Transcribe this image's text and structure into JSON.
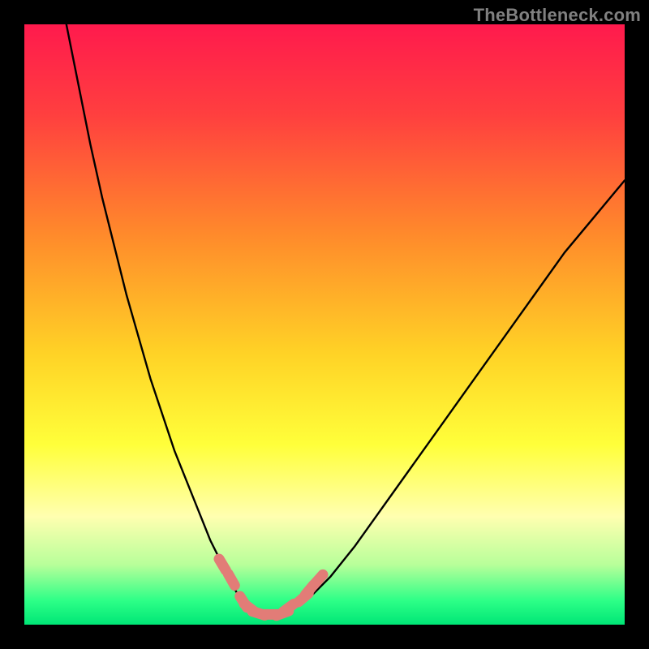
{
  "watermark": "TheBottleneck.com",
  "chart_data": {
    "type": "line",
    "title": "",
    "xlabel": "",
    "ylabel": "",
    "xlim": [
      0,
      100
    ],
    "ylim": [
      0,
      100
    ],
    "grid": false,
    "legend": false,
    "gradient_stops": [
      {
        "offset": 0.0,
        "color": "#ff1a4d"
      },
      {
        "offset": 0.15,
        "color": "#ff3f3f"
      },
      {
        "offset": 0.35,
        "color": "#ff8a2b"
      },
      {
        "offset": 0.55,
        "color": "#ffd326"
      },
      {
        "offset": 0.7,
        "color": "#ffff3a"
      },
      {
        "offset": 0.82,
        "color": "#ffffb0"
      },
      {
        "offset": 0.9,
        "color": "#b8ff9a"
      },
      {
        "offset": 0.96,
        "color": "#2dff87"
      },
      {
        "offset": 1.0,
        "color": "#00e676"
      }
    ],
    "series": [
      {
        "name": "left-curve",
        "stroke": "#000000",
        "x": [
          7,
          9,
          11,
          13,
          15,
          17,
          19,
          21,
          23,
          25,
          27,
          29,
          31,
          33,
          35,
          36.5,
          37.5
        ],
        "y": [
          100,
          90,
          80,
          71,
          63,
          55,
          48,
          41,
          35,
          29,
          24,
          19,
          14,
          10,
          6,
          3.5,
          2.5
        ]
      },
      {
        "name": "right-curve",
        "stroke": "#000000",
        "x": [
          44,
          46,
          48,
          51,
          55,
          60,
          65,
          70,
          75,
          80,
          85,
          90,
          95,
          100
        ],
        "y": [
          2.5,
          3.5,
          5,
          8,
          13,
          20,
          27,
          34,
          41,
          48,
          55,
          62,
          68,
          74
        ]
      },
      {
        "name": "valley-floor",
        "stroke": "#000000",
        "x": [
          37.5,
          39,
          41,
          43,
          44
        ],
        "y": [
          2.5,
          1.8,
          1.6,
          1.8,
          2.5
        ]
      }
    ],
    "markers": {
      "name": "highlight-dots",
      "stroke": "#e27c77",
      "points": [
        {
          "x": 33.0,
          "y": 10.0
        },
        {
          "x": 34.5,
          "y": 7.5
        },
        {
          "x": 36.5,
          "y": 3.8
        },
        {
          "x": 37.5,
          "y": 2.8
        },
        {
          "x": 39.0,
          "y": 1.9
        },
        {
          "x": 41.0,
          "y": 1.7
        },
        {
          "x": 43.0,
          "y": 1.9
        },
        {
          "x": 44.0,
          "y": 2.8
        },
        {
          "x": 46.5,
          "y": 4.5
        },
        {
          "x": 47.5,
          "y": 5.8
        },
        {
          "x": 49.0,
          "y": 7.5
        }
      ]
    }
  }
}
